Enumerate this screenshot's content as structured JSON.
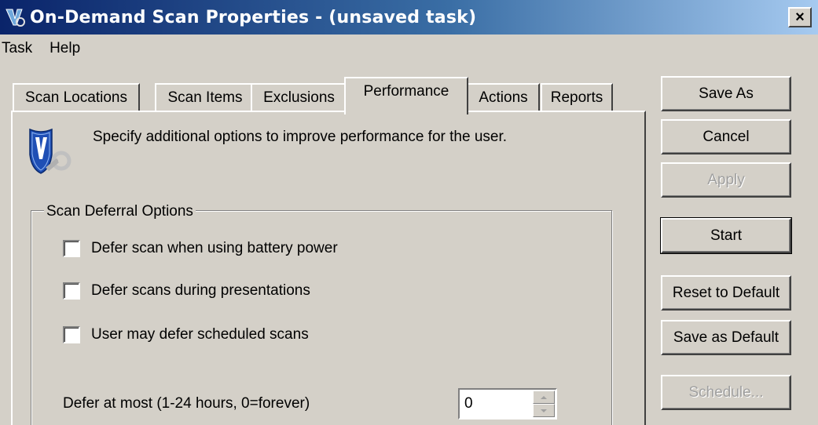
{
  "window": {
    "title": "On-Demand Scan Properties - (unsaved task)",
    "close_label": "×"
  },
  "menu": [
    "Task",
    "Help"
  ],
  "tabs": [
    {
      "label": "Scan Locations",
      "active": false
    },
    {
      "label": "Scan Items",
      "active": false
    },
    {
      "label": "Exclusions",
      "active": false
    },
    {
      "label": "Performance",
      "active": true
    },
    {
      "label": "Actions",
      "active": false
    },
    {
      "label": "Reports",
      "active": false
    }
  ],
  "panel": {
    "description": "Specify additional options to improve performance for the user.",
    "group_title": "Scan Deferral Options",
    "checkboxes": [
      {
        "label": "Defer scan when using battery power",
        "checked": false
      },
      {
        "label": "Defer scans during presentations",
        "checked": false
      },
      {
        "label": "User may defer scheduled scans",
        "checked": false
      }
    ],
    "defer_label": "Defer at most (1-24 hours, 0=forever)",
    "defer_value": "0"
  },
  "buttons": [
    {
      "label": "Save As",
      "enabled": true
    },
    {
      "label": "Cancel",
      "enabled": true
    },
    {
      "label": "Apply",
      "enabled": false
    },
    {
      "label": "Start",
      "enabled": true,
      "default": true
    },
    {
      "label": "Reset to Default",
      "enabled": true
    },
    {
      "label": "Save as Default",
      "enabled": true
    },
    {
      "label": "Schedule...",
      "enabled": false
    }
  ],
  "colors": {
    "titlebar_start": "#0a246a",
    "titlebar_end": "#a6caf0",
    "face": "#d4d0c8",
    "disabled_text": "#a0a0a0",
    "shield_blue": "#1f4fb5"
  }
}
